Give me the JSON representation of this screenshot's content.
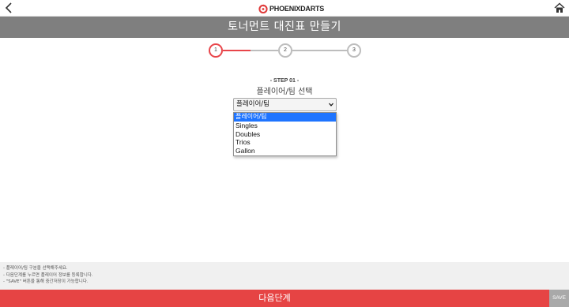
{
  "header": {
    "brand_text": "PHOENIXDARTS",
    "page_title": "토너먼트 대진표 만들기",
    "icons": {
      "back": "chevron-left-icon",
      "home": "home-icon",
      "logo": "phoenix-logo-icon"
    }
  },
  "stepper": {
    "steps": [
      "1",
      "2",
      "3"
    ],
    "current_step": 1,
    "accent_color": "#e8454a",
    "inactive_color": "#bdbdbd"
  },
  "step": {
    "heading": "- STEP 01 -",
    "title": "플레이어/팀 선택"
  },
  "select": {
    "current_value": "플레이어/팀",
    "options": [
      "플레이어/팀",
      "Singles",
      "Doubles",
      "Trios",
      "Gallon"
    ],
    "highlighted_option": "플레이어/팀"
  },
  "notes": [
    "- 플레이어/팀 구분을 선택해주세요.",
    "- 다음단계를 누르면 플레이어 정보를 등록합니다.",
    "- \"SAVE\" 버튼을 통해 중간저장이 가능합니다."
  ],
  "footer": {
    "next_label": "다음단계",
    "save_label": "SAVE",
    "next_color": "#e64444",
    "save_color": "#a9a9a9"
  }
}
